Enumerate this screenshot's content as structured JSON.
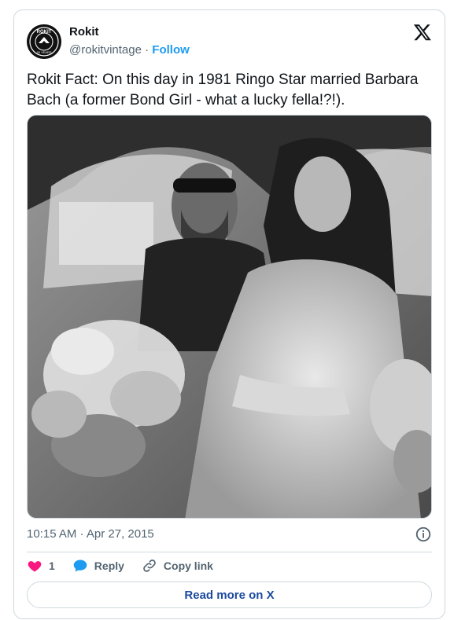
{
  "author": {
    "display_name": "Rokit",
    "handle": "@rokitvintage",
    "separator": "·",
    "follow_label": "Follow",
    "avatar_text": "ROKIT",
    "avatar_subtext": "30 YEARS"
  },
  "tweet": {
    "text": "Rokit Fact: On this day in 1981 Ringo Star married Barbara Bach (a former Bond Girl - what a lucky fella!?!).",
    "timestamp": "10:15 AM · Apr 27, 2015"
  },
  "actions": {
    "like_count": "1",
    "reply_label": "Reply",
    "copy_link_label": "Copy link"
  },
  "footer": {
    "read_more_label": "Read more on X"
  },
  "colors": {
    "accent": "#1d9bf0",
    "like": "#f91880",
    "text": "#0f1419",
    "muted": "#536471",
    "border": "#cfd9de"
  },
  "icons": {
    "platform": "x-logo-icon",
    "info": "info-icon",
    "like": "heart-icon",
    "reply": "speech-bubble-icon",
    "copy": "link-icon"
  }
}
